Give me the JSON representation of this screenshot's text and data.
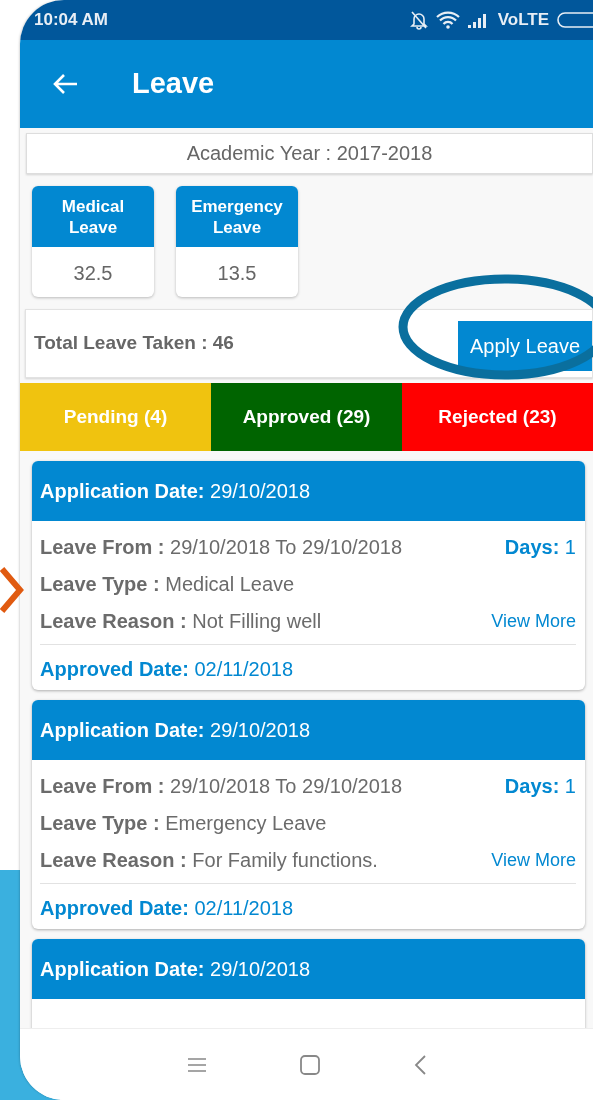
{
  "status_bar": {
    "time": "10:04 AM",
    "network": "VoLTE"
  },
  "app_bar": {
    "title": "Leave"
  },
  "academic_year": "Academic Year : 2017-2018",
  "leave_balances": [
    {
      "type": "Medical Leave",
      "balance": "32.5"
    },
    {
      "type": "Emergency Leave",
      "balance": "13.5"
    }
  ],
  "total": {
    "label": "Total Leave Taken : 46",
    "button": "Apply Leave"
  },
  "tabs": [
    {
      "label": "Pending (4)",
      "color": "#f0c30f"
    },
    {
      "label": "Approved (29)",
      "color": "#006400"
    },
    {
      "label": "Rejected (23)",
      "color": "#ff0000"
    }
  ],
  "applications": [
    {
      "header": "**Application Date:** 29/10/2018",
      "from": "**Leave From :** 29/10/2018 To 29/10/2018",
      "days": "**Days:** 1",
      "type": "**Leave Type :** Medical Leave",
      "reason": "**Leave Reason :** Not Filling well",
      "link": "View More",
      "approved": "**Approved Date:** 02/11/2018"
    },
    {
      "header": "**Application Date:** 29/10/2018",
      "from": "**Leave From :** 29/10/2018 To 29/10/2018",
      "days": "**Days:** 1",
      "type": "**Leave Type :** Emergency Leave",
      "reason": "**Leave Reason :** For Family functions.",
      "link": "View More",
      "approved": "**Approved Date:** 02/11/2018"
    },
    {
      "header": "**Application Date:** 29/10/2018"
    }
  ]
}
